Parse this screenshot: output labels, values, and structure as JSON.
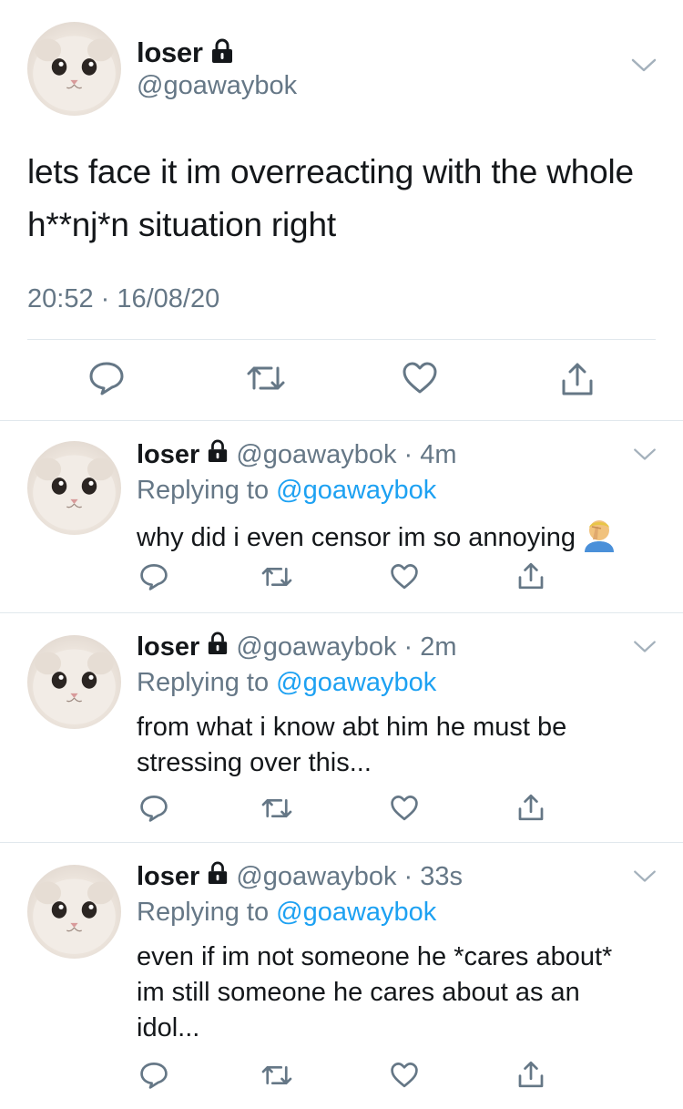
{
  "main_tweet": {
    "display_name": "loser",
    "handle": "@goawaybok",
    "text": "lets face it im overreacting with the whole h**nj*n situation right",
    "timestamp": "20:52 · 16/08/20"
  },
  "replies": [
    {
      "display_name": "loser",
      "handle_time": "@goawaybok · 4m",
      "replying_prefix": "Replying to ",
      "replying_to": "@goawaybok",
      "text": "why did i even censor im so annoying"
    },
    {
      "display_name": "loser",
      "handle_time": "@goawaybok · 2m",
      "replying_prefix": "Replying to ",
      "replying_to": "@goawaybok",
      "text": "from what i know abt him he must be stressing over this..."
    },
    {
      "display_name": "loser",
      "handle_time": "@goawaybok · 33s",
      "replying_prefix": "Replying to ",
      "replying_to": "@goawaybok",
      "text": "even if im not someone he *cares about* im still someone he cares about as an idol..."
    }
  ],
  "icons": {
    "lock": "lock-icon",
    "more": "chevron-down-icon",
    "reply": "reply-icon",
    "retweet": "retweet-icon",
    "like": "heart-icon",
    "share": "share-icon",
    "emoji": "face-palm-emoji"
  },
  "colors": {
    "text": "#14171a",
    "secondary": "#657786",
    "link": "#1da1f2",
    "divider": "#e1e8ed"
  }
}
